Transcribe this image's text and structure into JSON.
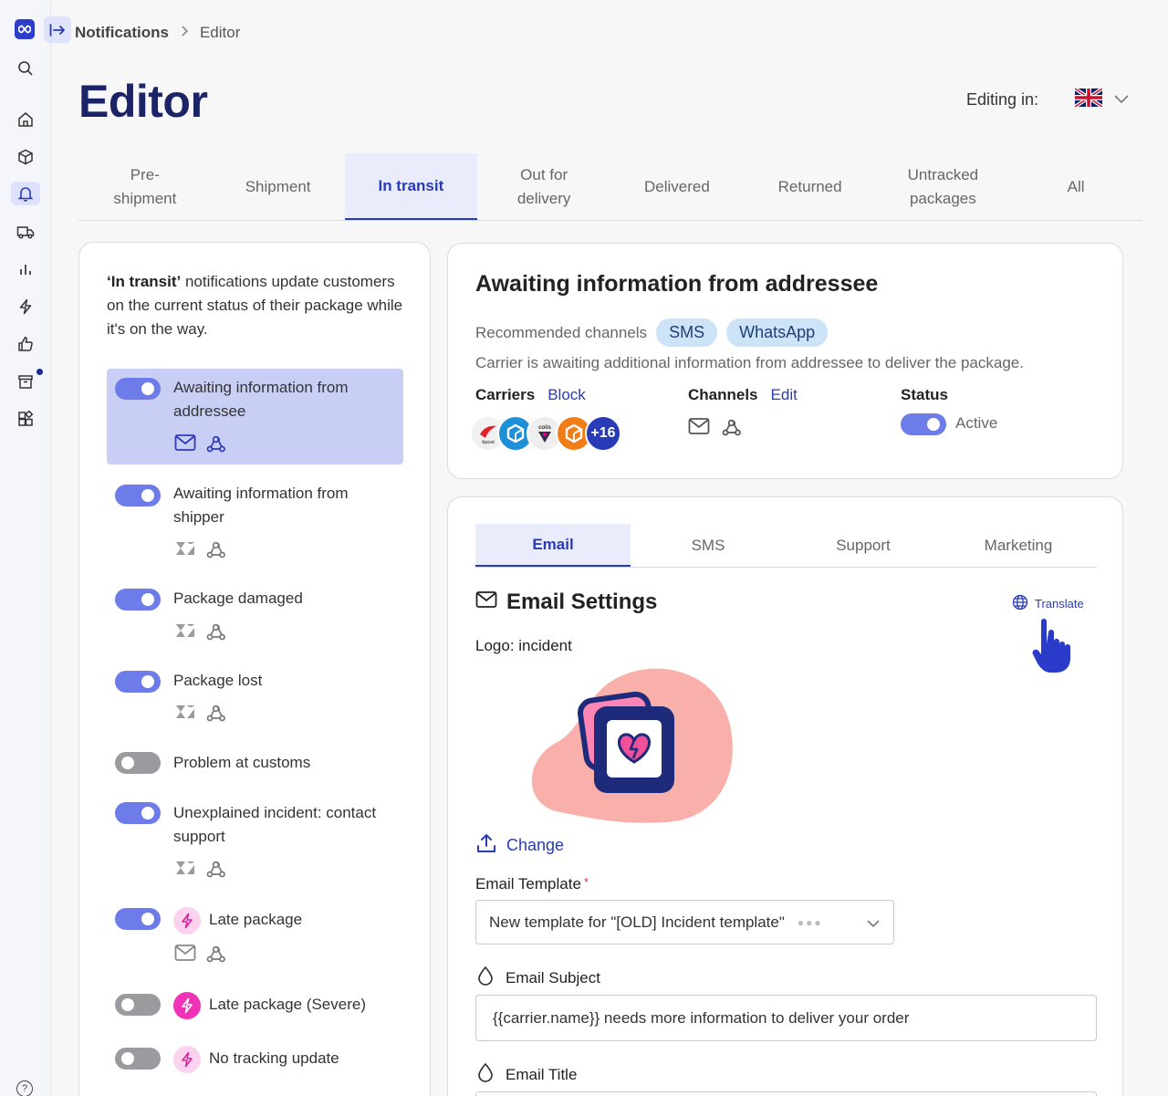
{
  "rail": {
    "icons": [
      "logo-icon",
      "search-icon",
      "home-icon",
      "package-icon",
      "bell-icon",
      "truck-icon",
      "chart-icon",
      "bolt-icon",
      "thumbs-up-icon",
      "archive-icon",
      "apps-icon",
      "help-icon"
    ],
    "active": "bell-icon"
  },
  "breadcrumb": {
    "parent": "Notifications",
    "current": "Editor"
  },
  "page": {
    "title": "Editor",
    "editing_label": "Editing in:",
    "language_flag": "uk-flag-icon"
  },
  "category_tabs": [
    {
      "label": "Pre-\nshipment",
      "active": false
    },
    {
      "label": "Shipment",
      "active": false
    },
    {
      "label": "In transit",
      "active": true
    },
    {
      "label": "Out for\ndelivery",
      "active": false
    },
    {
      "label": "Delivered",
      "active": false
    },
    {
      "label": "Returned",
      "active": false
    },
    {
      "label": "Untracked\npackages",
      "active": false
    },
    {
      "label": "All",
      "active": false
    }
  ],
  "left_panel": {
    "intro_bold": "‘In transit’",
    "intro_rest": " notifications update customers on the current status of their package while it's on the way.",
    "items": [
      {
        "label": "Awaiting information from addressee",
        "enabled": true,
        "selected": true,
        "icons": [
          "email-icon",
          "webhook-icon"
        ]
      },
      {
        "label": "Awaiting information from shipper",
        "enabled": true,
        "selected": false,
        "icons": [
          "zendesk-icon",
          "webhook-icon"
        ]
      },
      {
        "label": "Package damaged",
        "enabled": true,
        "selected": false,
        "icons": [
          "zendesk-icon",
          "webhook-icon"
        ]
      },
      {
        "label": "Package lost",
        "enabled": true,
        "selected": false,
        "icons": [
          "zendesk-icon",
          "webhook-icon"
        ]
      },
      {
        "label": "Problem at customs",
        "enabled": false,
        "selected": false,
        "icons": []
      },
      {
        "label": "Unexplained incident: contact support",
        "enabled": true,
        "selected": false,
        "icons": [
          "zendesk-icon",
          "webhook-icon"
        ]
      },
      {
        "label": "Late package",
        "enabled": true,
        "selected": false,
        "icons": [
          "email-icon",
          "webhook-icon"
        ],
        "badge": "bolt-light"
      },
      {
        "label": "Late package (Severe)",
        "enabled": false,
        "selected": false,
        "icons": [],
        "badge": "bolt-strong"
      },
      {
        "label": "No tracking update",
        "enabled": false,
        "selected": false,
        "icons": [],
        "badge": "bolt-light"
      }
    ]
  },
  "detail": {
    "title": "Awaiting information from addressee",
    "recommended_label": "Recommended channels",
    "recommended_channels": [
      "SMS",
      "WhatsApp"
    ],
    "description": "Carrier is awaiting additional information from addressee to deliver the package.",
    "carriers_label": "Carriers",
    "carriers_action": "Block",
    "carrier_logos": [
      "bpost-logo",
      "carrier-cube-logo",
      "colis-prive-logo",
      "carrier-orange-cube-logo"
    ],
    "carriers_more": "+16",
    "channels_label": "Channels",
    "channels_action": "Edit",
    "channel_icons": [
      "email-icon",
      "webhook-icon"
    ],
    "status_label": "Status",
    "status_value": "Active",
    "status_on": true
  },
  "settings": {
    "tabs": [
      {
        "label": "Email",
        "active": true
      },
      {
        "label": "SMS",
        "active": false
      },
      {
        "label": "Support",
        "active": false
      },
      {
        "label": "Marketing",
        "active": false
      }
    ],
    "title": "Email Settings",
    "translate_label": "Translate",
    "logo_label": "Logo: incident",
    "change_label": "Change",
    "template_label": "Email Template",
    "template_required": "*",
    "template_value": "New template for \"[OLD] Incident template\"",
    "subject_label": "Email Subject",
    "subject_value": "{{carrier.name}} needs more information to deliver your order",
    "title_label": "Email Title"
  },
  "colors": {
    "brand": "#2a3bb8",
    "heading": "#1a2466",
    "toggle_on": "#6d7ce8",
    "toggle_off": "#9a9a9f",
    "selected_row": "#c9cef4",
    "chip": "#cde3f8",
    "bolt": "#f032b6"
  }
}
